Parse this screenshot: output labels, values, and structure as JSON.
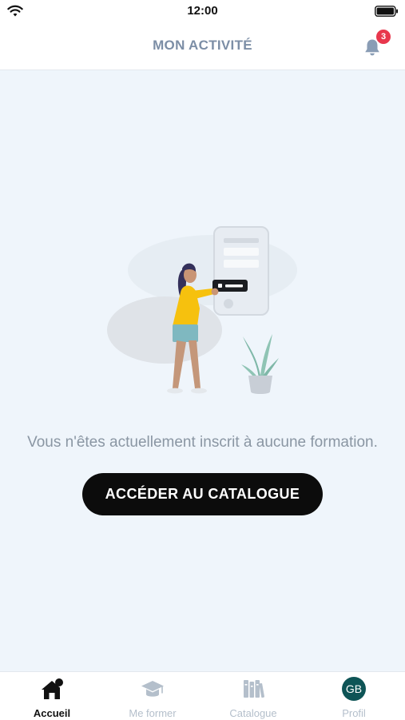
{
  "status_bar": {
    "time": "12:00"
  },
  "header": {
    "title": "MON ACTIVITÉ",
    "notification_count": "3"
  },
  "empty_state": {
    "message": "Vous n'êtes actuellement inscrit à aucune formation.",
    "cta_label": "ACCÉDER AU CATALOGUE"
  },
  "tabs": [
    {
      "label": "Accueil",
      "icon": "home-icon",
      "active": true
    },
    {
      "label": "Me former",
      "icon": "graduation-cap-icon",
      "active": false
    },
    {
      "label": "Catalogue",
      "icon": "books-icon",
      "active": false
    },
    {
      "label": "Profil",
      "icon": "avatar",
      "initials": "GB",
      "active": false
    }
  ],
  "colors": {
    "background": "#eff5fb",
    "title": "#7c8ea6",
    "badge": "#e8374d",
    "cta": "#0c0c0c",
    "avatar": "#0e5456",
    "tab_inactive": "#b4bfcb"
  }
}
